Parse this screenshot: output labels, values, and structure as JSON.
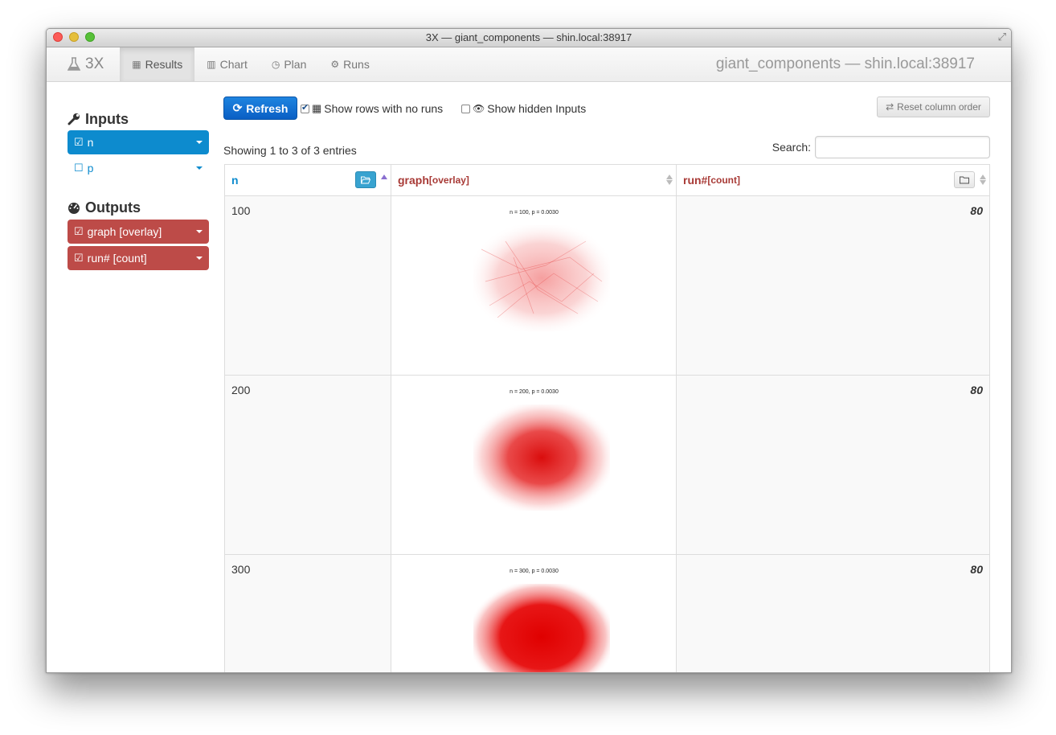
{
  "window": {
    "title": "3X — giant_components — shin.local:38917"
  },
  "navbar": {
    "brand": "3X",
    "tabs": [
      {
        "label": "Results",
        "icon": "table-icon"
      },
      {
        "label": "Chart",
        "icon": "bar-chart-icon"
      },
      {
        "label": "Plan",
        "icon": "clock-icon"
      },
      {
        "label": "Runs",
        "icon": "cogs-icon"
      }
    ],
    "right_text": "giant_components — shin.local:38917"
  },
  "sidebar": {
    "inputs_heading": "Inputs",
    "inputs": [
      {
        "label": "n",
        "checked": true
      },
      {
        "label": "p",
        "checked": false
      }
    ],
    "outputs_heading": "Outputs",
    "outputs": [
      {
        "label": "graph [overlay]",
        "checked": true
      },
      {
        "label": "run# [count]",
        "checked": true
      }
    ]
  },
  "toolbar": {
    "refresh_label": "Refresh",
    "show_rows_label": "Show rows with no runs",
    "show_hidden_label": "Show hidden Inputs",
    "reset_label": "Reset column order"
  },
  "table": {
    "info": "Showing 1 to 3 of 3 entries",
    "search_label": "Search:",
    "search_value": "",
    "columns": [
      {
        "name": "n",
        "sub": ""
      },
      {
        "name": "graph",
        "sub": "[overlay]"
      },
      {
        "name": "run#",
        "sub": "[count]"
      }
    ],
    "rows": [
      {
        "n": "100",
        "plot_title": "n = 100, p = 0.0030",
        "count": "80"
      },
      {
        "n": "200",
        "plot_title": "n = 200, p = 0.0030",
        "count": "80"
      },
      {
        "n": "300",
        "plot_title": "n = 300, p = 0.0030",
        "count": "80"
      }
    ]
  },
  "colors": {
    "input_blue": "#0d8bce",
    "output_red": "#bd4b48",
    "refresh_blue": "#1e84e0",
    "graph_red": "#e00000"
  }
}
